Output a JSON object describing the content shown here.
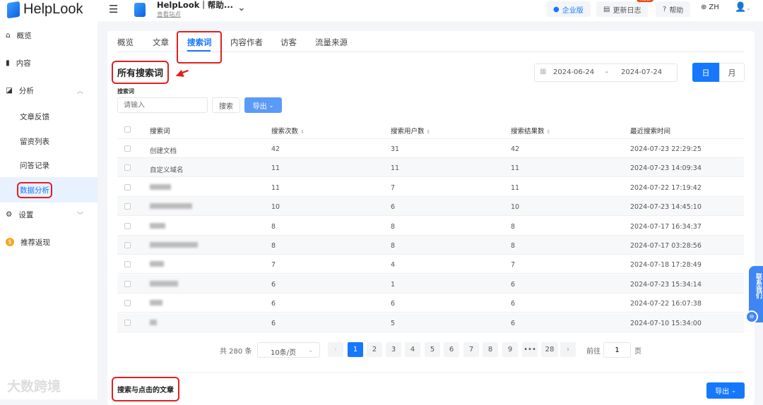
{
  "app": {
    "name": "HelpLook",
    "site_title": "HelpLook｜帮助...",
    "site_link": "查看站点"
  },
  "header": {
    "enterprise": "企业版",
    "changelog": "更新日志",
    "new_badge": "new",
    "help": "帮助",
    "lang": "ZH"
  },
  "sidebar": {
    "items": [
      {
        "label": "概览"
      },
      {
        "label": "内容"
      },
      {
        "label": "分析"
      },
      {
        "label": "文章反馈"
      },
      {
        "label": "留资列表"
      },
      {
        "label": "问答记录"
      },
      {
        "label": "数据分析"
      },
      {
        "label": "设置"
      },
      {
        "label": "推荐返现"
      }
    ]
  },
  "tabs": [
    {
      "label": "概览"
    },
    {
      "label": "文章"
    },
    {
      "label": "搜索词"
    },
    {
      "label": "内容作者"
    },
    {
      "label": "访客"
    },
    {
      "label": "流量来源"
    }
  ],
  "section_title": "所有搜索词",
  "date": {
    "start": "2024-06-24",
    "sep": "-",
    "end": "2024-07-24"
  },
  "granularity": {
    "day": "日",
    "month": "月"
  },
  "filter": {
    "label": "搜索词",
    "placeholder": "请输入",
    "search": "搜索",
    "export": "导出"
  },
  "table": {
    "headers": [
      "搜索词",
      "搜索次数",
      "搜索用户数",
      "搜索结果数",
      "最近搜索时间"
    ],
    "rows": [
      {
        "term": "创建文档",
        "count": "42",
        "users": "31",
        "results": "42",
        "time": "2024-07-23 22:29:25"
      },
      {
        "term": "自定义域名",
        "count": "11",
        "users": "11",
        "results": "11",
        "time": "2024-07-23 14:09:34"
      },
      {
        "term": "",
        "count": "11",
        "users": "7",
        "results": "11",
        "time": "2024-07-22 17:19:42"
      },
      {
        "term": "",
        "count": "10",
        "users": "6",
        "results": "10",
        "time": "2024-07-23 14:45:10"
      },
      {
        "term": "",
        "count": "8",
        "users": "8",
        "results": "8",
        "time": "2024-07-17 16:34:37"
      },
      {
        "term": "",
        "count": "8",
        "users": "8",
        "results": "8",
        "time": "2024-07-17 03:28:56"
      },
      {
        "term": "",
        "count": "7",
        "users": "4",
        "results": "7",
        "time": "2024-07-18 17:28:49"
      },
      {
        "term": "",
        "count": "6",
        "users": "1",
        "results": "6",
        "time": "2024-07-23 15:34:14"
      },
      {
        "term": "",
        "count": "6",
        "users": "6",
        "results": "6",
        "time": "2024-07-22 16:07:38"
      },
      {
        "term": "",
        "count": "6",
        "users": "5",
        "results": "6",
        "time": "2024-07-10 15:34:00"
      }
    ]
  },
  "pagination": {
    "total": "共 280 条",
    "page_size": "10条/页",
    "pages": [
      "1",
      "2",
      "3",
      "4",
      "5",
      "6",
      "7",
      "8",
      "9",
      "•••",
      "28"
    ],
    "goto": "前往",
    "goto_value": "1",
    "page_suffix": "页"
  },
  "section2_title": "搜索与点击的文章",
  "export2": "导出",
  "contact": "联系我们",
  "watermark": "大数跨境"
}
